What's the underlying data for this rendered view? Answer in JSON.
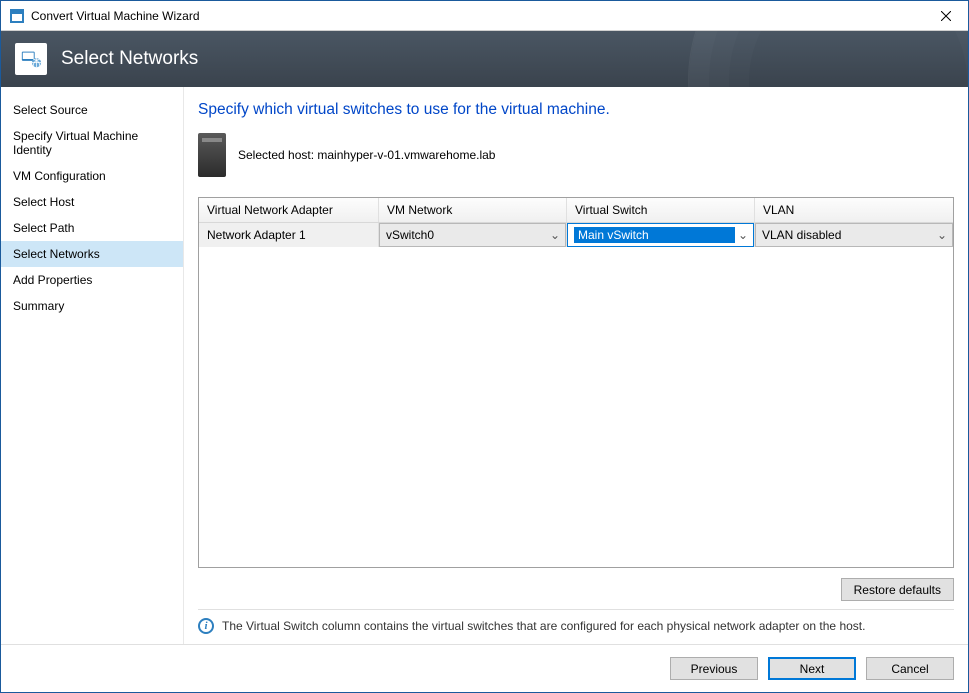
{
  "window": {
    "title": "Convert Virtual Machine Wizard"
  },
  "banner": {
    "title": "Select Networks"
  },
  "sidebar": {
    "items": [
      {
        "label": "Select Source",
        "selected": false
      },
      {
        "label": "Specify Virtual Machine Identity",
        "selected": false
      },
      {
        "label": "VM Configuration",
        "selected": false
      },
      {
        "label": "Select Host",
        "selected": false
      },
      {
        "label": "Select Path",
        "selected": false
      },
      {
        "label": "Select Networks",
        "selected": true
      },
      {
        "label": "Add Properties",
        "selected": false
      },
      {
        "label": "Summary",
        "selected": false
      }
    ]
  },
  "main": {
    "instruction": "Specify which virtual switches to use for the virtual machine.",
    "host_label_prefix": "Selected host: ",
    "host_name": "mainhyper-v-01.vmwarehome.lab",
    "grid": {
      "headers": {
        "adapter": "Virtual Network Adapter",
        "network": "VM Network",
        "switch": "Virtual Switch",
        "vlan": "VLAN"
      },
      "rows": [
        {
          "adapter": "Network Adapter 1",
          "network": "vSwitch0",
          "switch": "Main vSwitch",
          "vlan": "VLAN disabled"
        }
      ]
    },
    "restore_label": "Restore defaults",
    "info_text": "The Virtual Switch column contains the virtual switches that are configured for each physical network adapter on the host."
  },
  "footer": {
    "previous": "Previous",
    "next": "Next",
    "cancel": "Cancel"
  }
}
